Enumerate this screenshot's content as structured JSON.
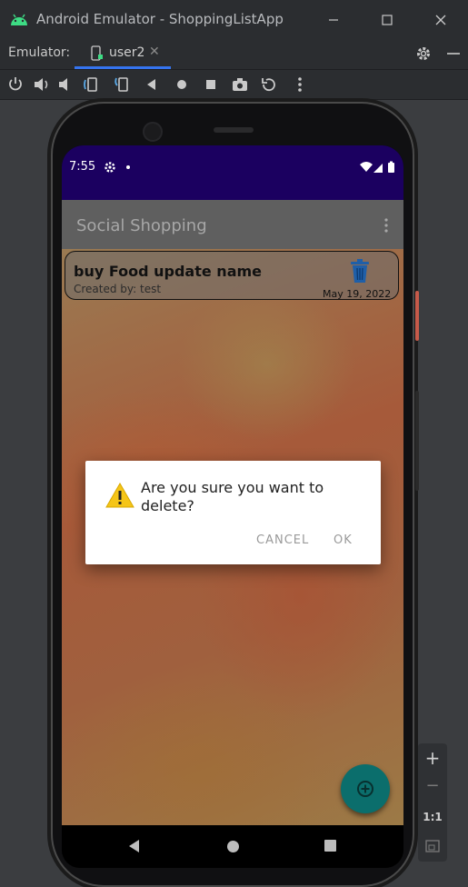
{
  "window": {
    "title": "Android Emulator - ShoppingListApp"
  },
  "emulator": {
    "label": "Emulator:",
    "tab_name": "user2"
  },
  "phone": {
    "status": {
      "time": "7:55"
    },
    "app_title": "Social Shopping",
    "card": {
      "title": "buy Food update name",
      "created_by": "Created by: test",
      "date": "May 19, 2022"
    },
    "dialog": {
      "message": "Are you sure you want to delete?",
      "cancel_label": "CANCEL",
      "ok_label": "OK"
    }
  },
  "zoom_controls": {
    "zoom_in": "+",
    "zoom_out": "−",
    "actual_size": "1:1"
  },
  "colors": {
    "statusbar": "#1b0060",
    "fab": "#0b6e6c",
    "trash": "#1f5fa8",
    "warning": "#f5c518",
    "accent_tab": "#3574f0"
  }
}
